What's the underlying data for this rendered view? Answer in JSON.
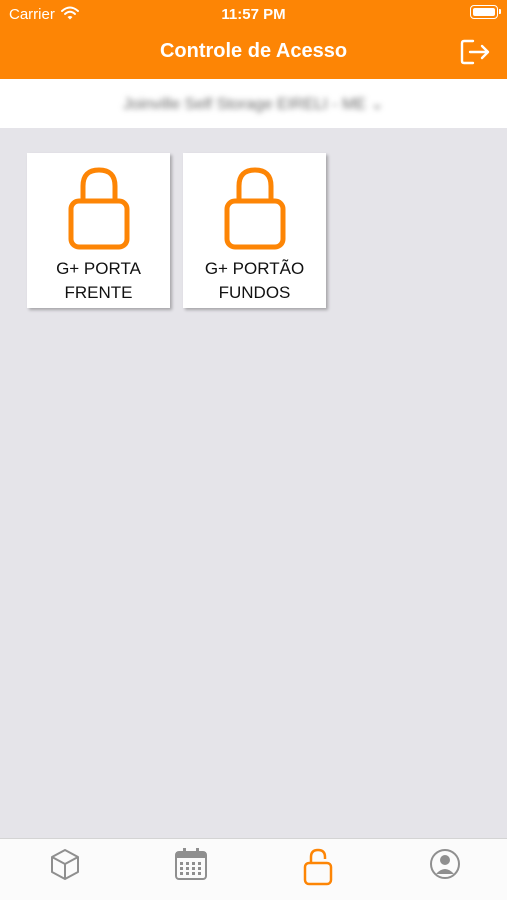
{
  "status_bar": {
    "carrier": "Carrier",
    "time": "11:57 PM"
  },
  "header": {
    "title": "Controle de Acesso"
  },
  "facility_selector": {
    "label": "Joinville Self Storage EIRELI - ME ⌄"
  },
  "doors": [
    {
      "label": "G+ PORTA\nFRENTE",
      "locked": true
    },
    {
      "label": "G+ PORTÃO\nFUNDOS",
      "locked": true
    }
  ],
  "tabs": [
    {
      "icon": "box-icon",
      "active": false
    },
    {
      "icon": "calendar-icon",
      "active": false
    },
    {
      "icon": "unlock-icon",
      "active": true
    },
    {
      "icon": "user-profile-icon",
      "active": false
    }
  ],
  "colors": {
    "accent": "#fd8505",
    "background": "#e5e4e9",
    "tab_inactive": "#8f8f8f"
  }
}
